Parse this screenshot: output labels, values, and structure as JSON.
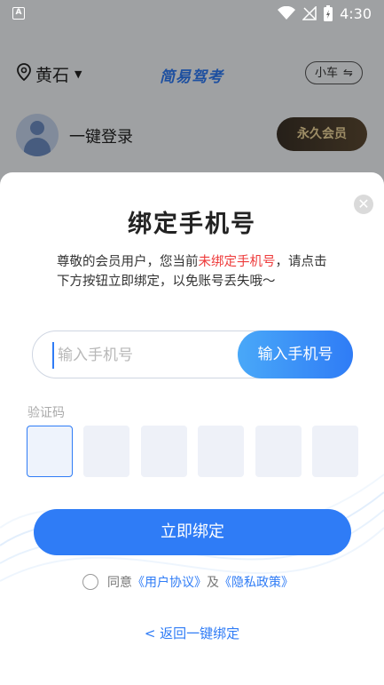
{
  "status_bar": {
    "app_badge": "A",
    "time": "4:30"
  },
  "header": {
    "city": "黄石",
    "brand": "简易驾考",
    "car_type": "小车",
    "swap_icon": "⇋"
  },
  "user": {
    "login_text": "一键登录",
    "vip_label": "永久会员"
  },
  "modal": {
    "close_symbol": "✕",
    "title": "绑定手机号",
    "desc_part1": "尊敬的会员用户，您当前",
    "desc_highlight": "未绑定手机号",
    "desc_part2": "，请点击下方按钮立即绑定，以免账号丢失哦～",
    "phone_placeholder": "输入手机号",
    "phone_button": "输入手机号",
    "code_label": "验证码",
    "bind_button": "立即绑定",
    "agree_prefix": "同意",
    "user_agreement": "《用户协议》",
    "agree_and": "及",
    "privacy_policy": "《隐私政策》",
    "back_link": "< 返回一键绑定"
  },
  "colors": {
    "accent": "#2f7cf6",
    "highlight": "#ee3b3b"
  }
}
